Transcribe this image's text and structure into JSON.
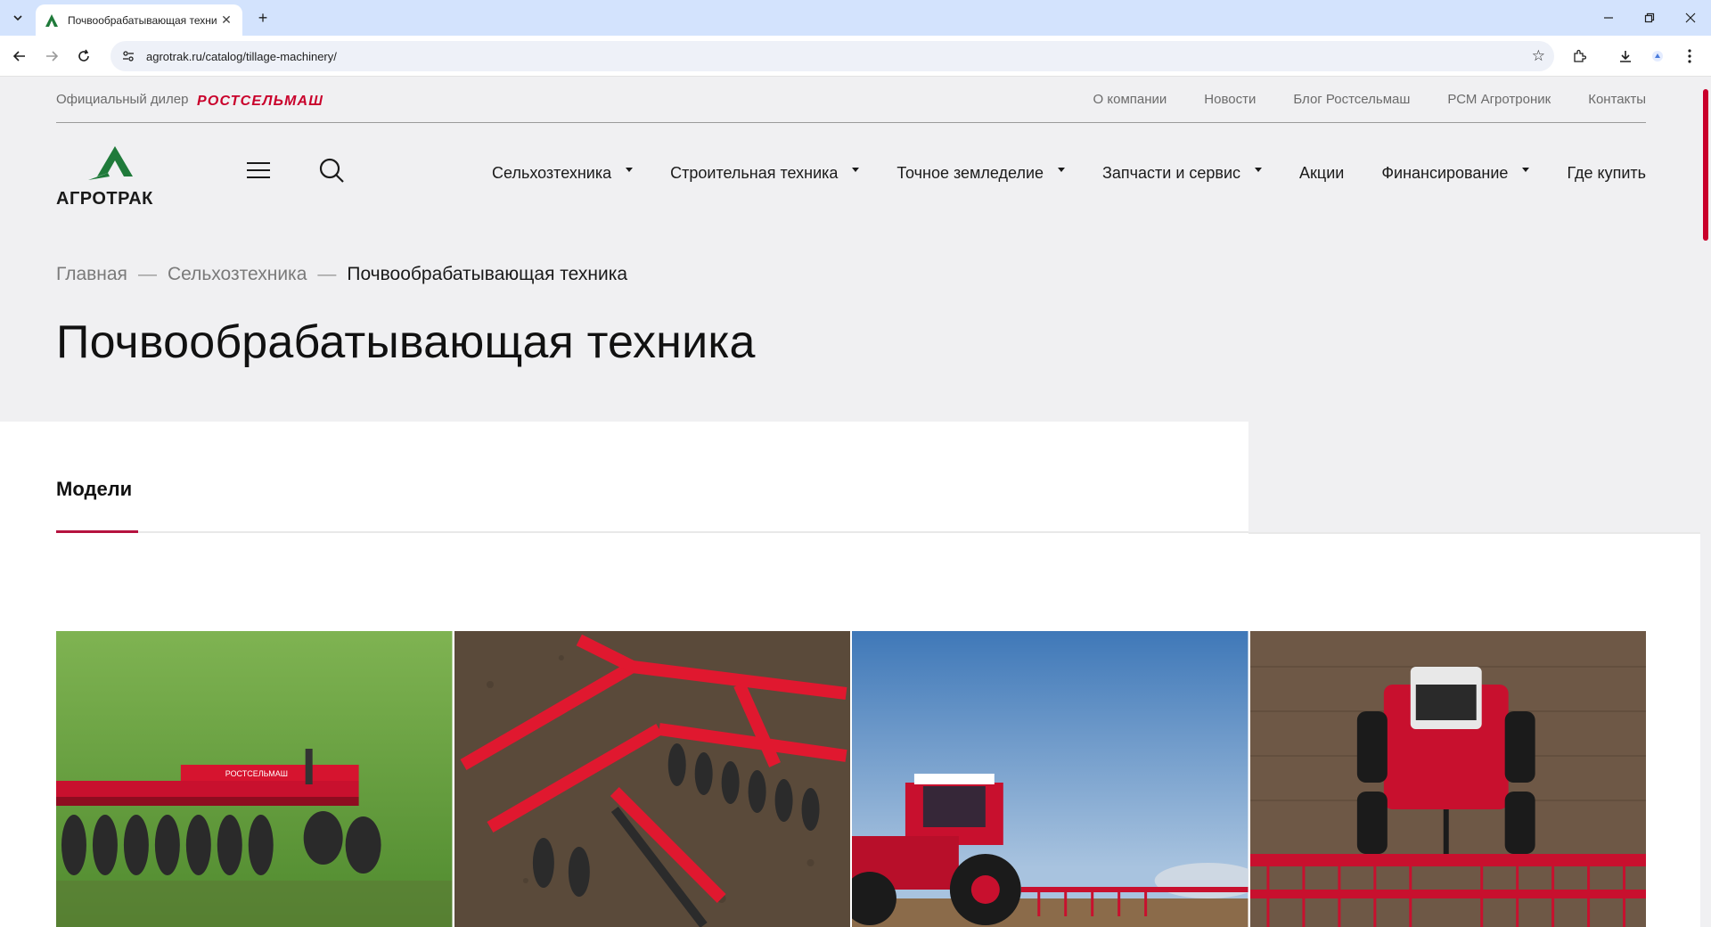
{
  "browser": {
    "tab_title": "Почвообрабатывающая техника",
    "url": "agrotrak.ru/catalog/tillage-machinery/"
  },
  "topbar": {
    "dealer_label": "Официальный дилер",
    "brand": "РОСТСЕЛЬМАШ",
    "links": [
      "О компании",
      "Новости",
      "Блог Ростсельмаш",
      "РСМ Агротроник",
      "Контакты"
    ]
  },
  "header": {
    "logo_text": "АГРОТРАК",
    "nav": [
      {
        "label": "Сельхозтехника",
        "dropdown": true
      },
      {
        "label": "Строительная техника",
        "dropdown": true
      },
      {
        "label": "Точное земледелие",
        "dropdown": true
      },
      {
        "label": "Запчасти и сервис",
        "dropdown": true
      },
      {
        "label": "Акции",
        "dropdown": false
      },
      {
        "label": "Финансирование",
        "dropdown": true
      },
      {
        "label": "Где купить",
        "dropdown": false
      }
    ]
  },
  "breadcrumb": [
    "Главная",
    "Сельхозтехника",
    "Почвообрабатывающая техника"
  ],
  "page_title": "Почвообрабатывающая техника",
  "tabs": {
    "active": "Модели"
  },
  "cards": [
    {
      "image": "disc-harrow-on-grass"
    },
    {
      "image": "disc-harrow-closeup"
    },
    {
      "image": "tractor-with-cultivator-sky"
    },
    {
      "image": "tractor-aerial-field"
    }
  ],
  "colors": {
    "accent": "#b5123f",
    "brand_red": "#c9002b",
    "logo_green": "#1f7a3a",
    "page_bg": "#f0f0f2"
  }
}
